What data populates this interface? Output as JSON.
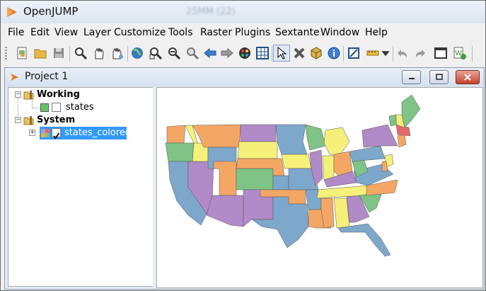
{
  "app": {
    "title": "OpenJUMP",
    "blurred_title": "25MM (22)"
  },
  "menu": [
    "File",
    "Edit",
    "View",
    "Layer",
    "Customize",
    "Tools",
    "Raster",
    "Plugins",
    "Sextante",
    "Window",
    "Help"
  ],
  "toolbar_icons": [
    "new-project-icon",
    "open-folder-icon",
    "save-icon",
    "zoom-icon",
    "pan-icon",
    "pan-layer-icon",
    "zoom-full-icon",
    "zoom-in-icon",
    "zoom-out-icon",
    "zoom-to-selection-icon",
    "previous-view-icon",
    "next-view-icon",
    "layer-style-icon",
    "grid-icon",
    "select-arrow-icon",
    "delete-edit-icon",
    "box-3d-icon",
    "info-icon",
    "edit-toolbox-icon",
    "measure-ruler-icon",
    "undo-icon",
    "redo-icon",
    "output-window-icon",
    "workbench-icon"
  ],
  "project": {
    "title": "Project 1"
  },
  "tree": {
    "categories": [
      {
        "name": "Working",
        "layers": [
          {
            "name": "states",
            "checked": false,
            "color": "#66c266"
          }
        ]
      },
      {
        "name": "System",
        "layers": [
          {
            "name": "states_colored",
            "checked": true,
            "selected": true
          }
        ]
      }
    ]
  },
  "map_colors": {
    "blue": "#7ea7cc",
    "green": "#7fc486",
    "orange": "#f4a765",
    "purple": "#b18ac8",
    "yellow": "#f5f07a"
  }
}
